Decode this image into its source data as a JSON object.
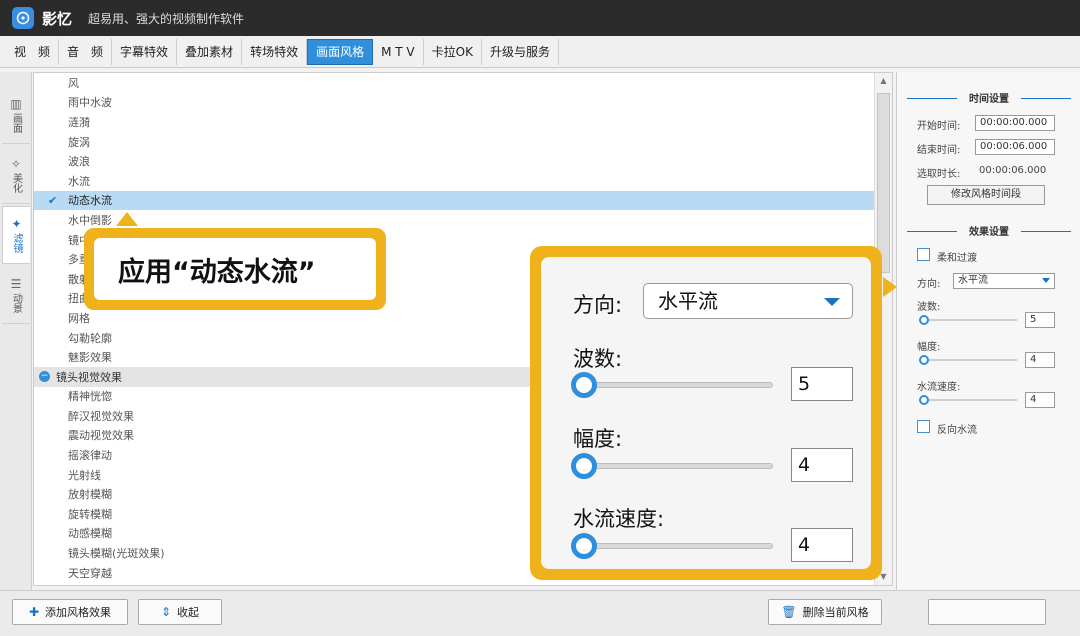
{
  "app": {
    "name": "影忆",
    "slogan": "超易用、强大的视频制作软件"
  },
  "toolbar": {
    "tabs": [
      "视　频",
      "音　频",
      "字幕特效",
      "叠加素材",
      "转场特效",
      "画面风格",
      "M T V",
      "卡拉OK",
      "升级与服务"
    ],
    "active": "画面风格"
  },
  "sidebar": {
    "tabs": [
      {
        "label": "画面",
        "icon": "film-icon"
      },
      {
        "label": "美化",
        "icon": "magic-wand-icon"
      },
      {
        "label": "滤镜",
        "icon": "filter-wand-icon"
      },
      {
        "label": "动景",
        "icon": "motion-icon"
      }
    ],
    "active": "滤镜"
  },
  "list": {
    "items": [
      {
        "label": "风"
      },
      {
        "label": "雨中水波"
      },
      {
        "label": "涟漪"
      },
      {
        "label": "旋涡"
      },
      {
        "label": "波浪"
      },
      {
        "label": "水流"
      },
      {
        "label": "动态水流",
        "selected": true
      },
      {
        "label": "水中倒影"
      },
      {
        "label": "镜中"
      },
      {
        "label": "多重"
      },
      {
        "label": "散射"
      },
      {
        "label": "扭曲"
      },
      {
        "label": "网格"
      },
      {
        "label": "勾勒轮廓"
      },
      {
        "label": "魅影效果"
      },
      {
        "label": "镜头视觉效果",
        "group": true
      },
      {
        "label": "精神恍惚"
      },
      {
        "label": "醉汉视觉效果"
      },
      {
        "label": "震动视觉效果"
      },
      {
        "label": "摇滚律动"
      },
      {
        "label": "光射线"
      },
      {
        "label": "放射模糊"
      },
      {
        "label": "旋转模糊"
      },
      {
        "label": "动感模糊"
      },
      {
        "label": "镜头模糊(光斑效果)"
      },
      {
        "label": "天空穿越"
      }
    ]
  },
  "callout_apply": {
    "text": "应用“动态水流”"
  },
  "callout_settings": {
    "direction_label": "方向:",
    "direction_value": "水平流",
    "waves_label": "波数:",
    "waves_value": "5",
    "amplitude_label": "幅度:",
    "amplitude_value": "4",
    "speed_label": "水流速度:",
    "speed_value": "4"
  },
  "right_panel": {
    "time_section": "时间设置",
    "start_label": "开始时间:",
    "start_value": "00:00:00.000",
    "end_label": "结束时间:",
    "end_value": "00:00:06.000",
    "duration_label": "选取时长:",
    "duration_value": "00:00:06.000",
    "modify_button": "修改风格时间段",
    "effect_section": "效果设置",
    "soft_transition": "柔和过渡",
    "direction_label": "方向:",
    "direction_value": "水平流",
    "waves_label": "波数:",
    "waves_value": "5",
    "amplitude_label": "幅度:",
    "amplitude_value": "4",
    "speed_label": "水流速度:",
    "speed_value": "4",
    "reverse_flow": "反向水流"
  },
  "bottom": {
    "add_button": "添加风格效果",
    "collapse_button": "收起",
    "delete_button": "删除当前风格"
  },
  "colors": {
    "accent": "#2f8fdc",
    "callout": "#f0b21b",
    "selected_row": "#b9daf3",
    "titlebar": "#2b2b2b"
  }
}
